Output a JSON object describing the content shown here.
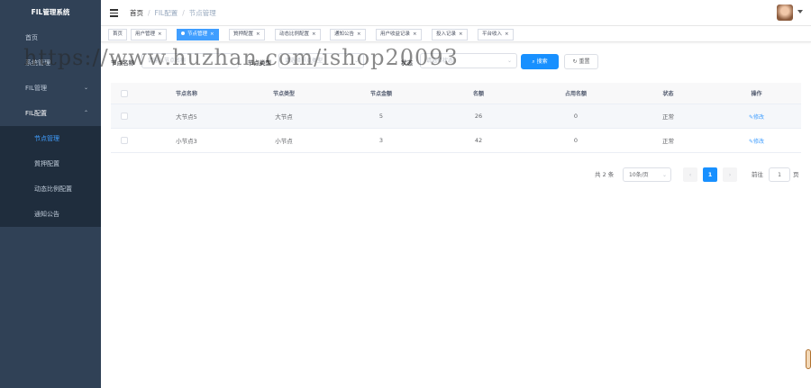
{
  "app": {
    "title": "FIL管理系统"
  },
  "sidebar": {
    "items": [
      {
        "label": "首页"
      },
      {
        "label": "系统管理"
      },
      {
        "label": "FIL管理",
        "arrow": "⌄"
      },
      {
        "label": "FIL配置",
        "arrow": "⌃"
      }
    ],
    "submenu": [
      {
        "label": "节点管理"
      },
      {
        "label": "質押配置"
      },
      {
        "label": "动态比例配置"
      },
      {
        "label": "通知公告"
      }
    ]
  },
  "breadcrumb": {
    "home": "首页",
    "section": "FIL配置",
    "current": "节点管理",
    "sep": "/"
  },
  "tags": [
    {
      "label": "首页",
      "close": ""
    },
    {
      "label": "用户管理",
      "close": "×"
    },
    {
      "label": "节点管理",
      "close": "×"
    },
    {
      "label": "質押配置",
      "close": "×"
    },
    {
      "label": "动态比例配置",
      "close": "×"
    },
    {
      "label": "通知公告",
      "close": "×"
    },
    {
      "label": "用户收益记录",
      "close": "×"
    },
    {
      "label": "投入记录",
      "close": "×"
    },
    {
      "label": "平台收入",
      "close": "×"
    }
  ],
  "search": {
    "name_label": "节点名称",
    "name_placeholder": "请输入节点名称",
    "type_label": "节点类型",
    "type_placeholder": "请选择节点类型",
    "status_label": "状态",
    "status_placeholder": "请选择状态",
    "caret": "⌄",
    "search_button": "搜索",
    "reset_button": "重置"
  },
  "table": {
    "columns": [
      "节点名称",
      "节点类型",
      "节点金额",
      "名额",
      "占用名额",
      "状态",
      "操作"
    ],
    "rows": [
      {
        "name": "大节点5",
        "type": "大节点",
        "amount": "5",
        "quota": "26",
        "used": "0",
        "status": "正常",
        "action": "修改"
      },
      {
        "name": "小节点3",
        "type": "小节点",
        "amount": "3",
        "quota": "42",
        "used": "0",
        "status": "正常",
        "action": "修改"
      }
    ]
  },
  "pagination": {
    "total": "共 2 条",
    "page_size": "10条/页",
    "prev": "‹",
    "current": "1",
    "next": "›",
    "goto_label": "前往",
    "goto_value": "1",
    "goto_suffix": "页"
  },
  "watermark": "https://www.huzhan.com/ishop20093",
  "colors": {
    "sidebar": "#304156",
    "primary": "#1890ff",
    "link": "#409eff"
  }
}
